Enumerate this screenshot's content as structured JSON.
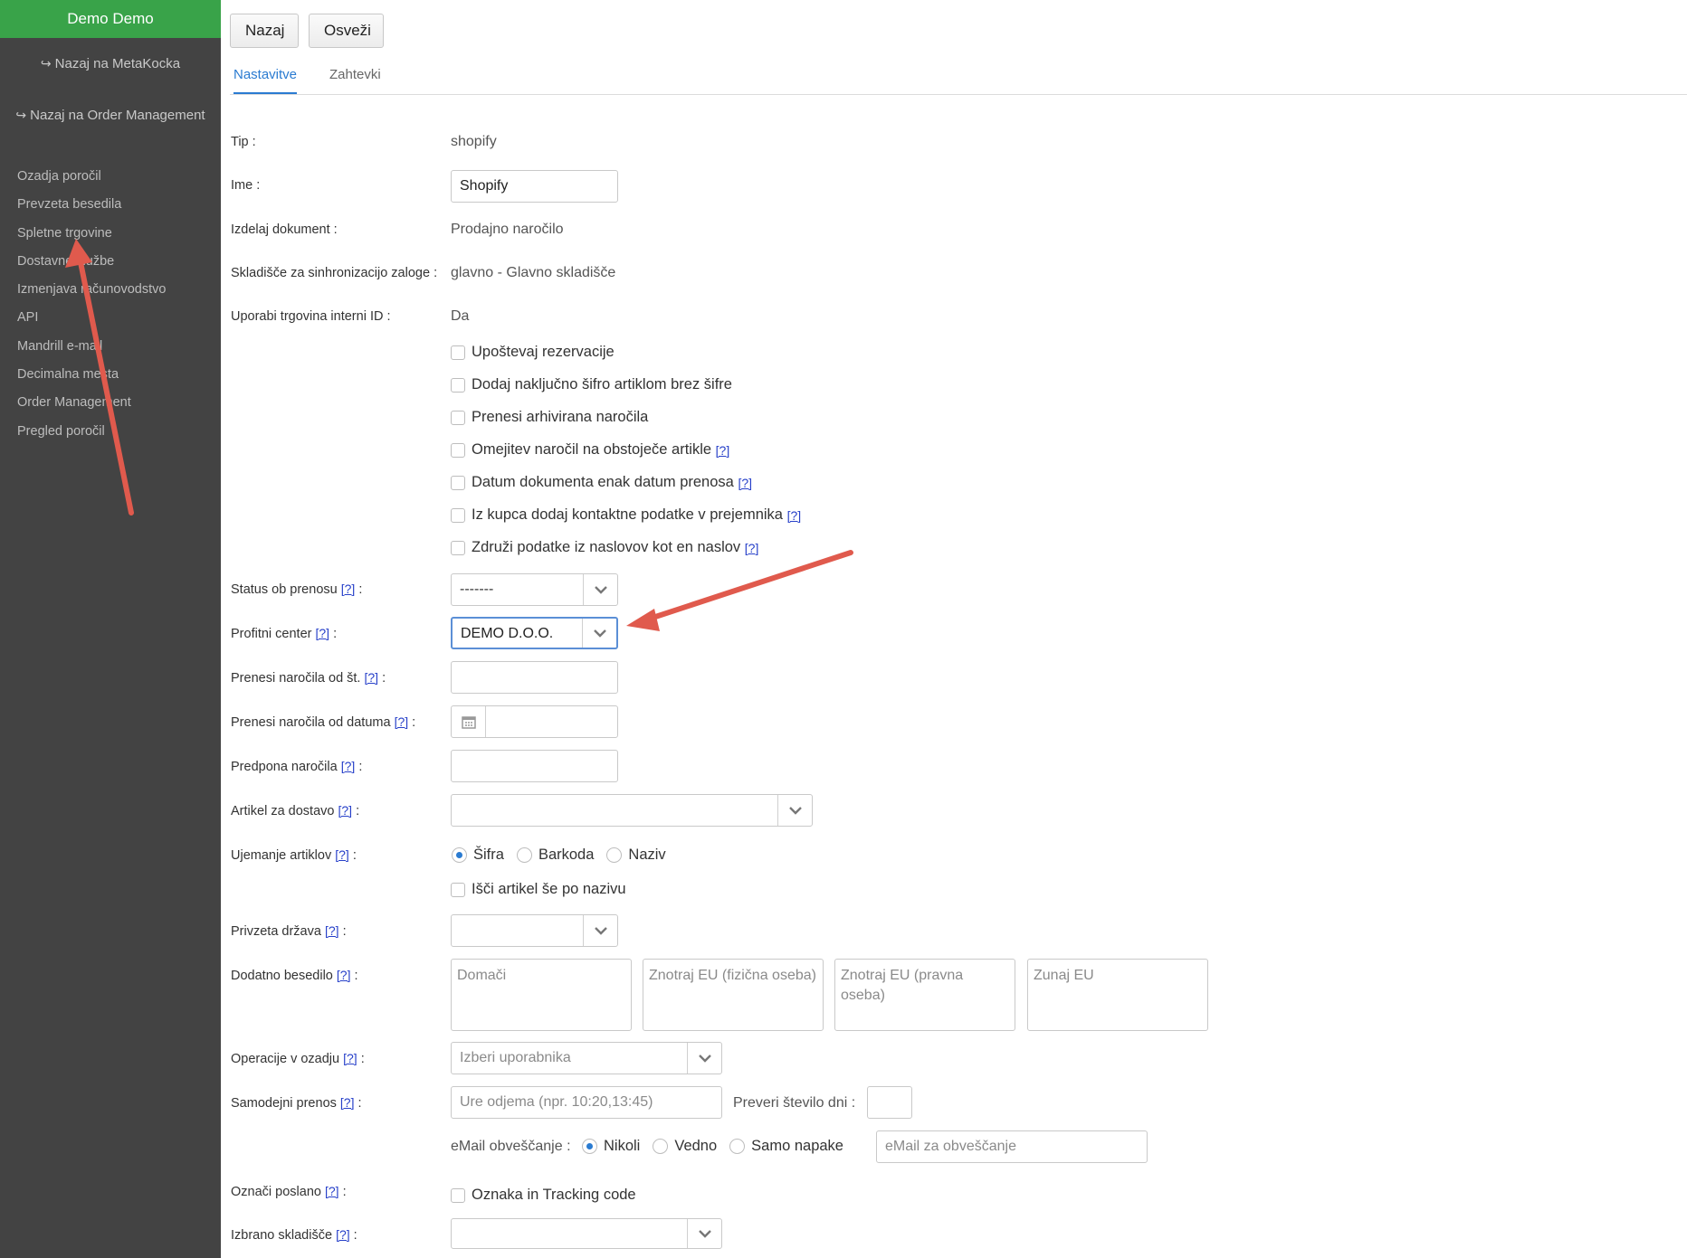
{
  "sidebar": {
    "user_name": "Demo Demo",
    "back_metakocka": "Nazaj na MetaKocka",
    "back_order_mgmt": "Nazaj na Order Management",
    "items": [
      {
        "label": "Ozadja poročil"
      },
      {
        "label": "Prevzeta besedila"
      },
      {
        "label": "Spletne trgovine"
      },
      {
        "label": "Dostavne službe"
      },
      {
        "label": "Izmenjava računovodstvo"
      },
      {
        "label": "API"
      },
      {
        "label": "Mandrill e-mail"
      },
      {
        "label": "Decimalna mesta"
      },
      {
        "label": "Order Management"
      },
      {
        "label": "Pregled poročil"
      }
    ]
  },
  "toolbar": {
    "back_label": "Nazaj",
    "refresh_label": "Osveži"
  },
  "tabs": {
    "settings": "Nastavitve",
    "requests": "Zahtevki"
  },
  "help_text": "[?]",
  "form": {
    "tip": {
      "label": "Tip :",
      "value": "shopify"
    },
    "ime": {
      "label": "Ime :",
      "value": "Shopify"
    },
    "izdelaj_dokument": {
      "label": "Izdelaj dokument :",
      "value": "Prodajno naročilo"
    },
    "skladisce_sinhro": {
      "label": "Skladišče za sinhronizacijo zaloge :",
      "value": "glavno - Glavno skladišče"
    },
    "interni_id": {
      "label": "Uporabi trgovina interni ID :",
      "value": "Da"
    },
    "checkboxes": [
      {
        "label": "Upoštevaj rezervacije",
        "checked": false
      },
      {
        "label": "Dodaj naključno šifro artiklom brez šifre",
        "checked": false
      },
      {
        "label": "Prenesi arhivirana naročila",
        "checked": false
      },
      {
        "label": "Omejitev naročil na obstoječe artikle",
        "checked": false
      },
      {
        "label": "Datum dokumenta enak datum prenosa",
        "checked": false
      },
      {
        "label": "Iz kupca dodaj kontaktne podatke v prejemnika",
        "checked": false
      },
      {
        "label": "Združi podatke iz naslovov kot en naslov",
        "checked": false
      }
    ],
    "status_ob_prenosu": {
      "label": "Status ob prenosu",
      "value": "-------"
    },
    "profitni_center": {
      "label": "Profitni center",
      "value": "DEMO D.O.O."
    },
    "prenesi_od_st": {
      "label": "Prenesi naročila od št.",
      "value": ""
    },
    "prenesi_od_datuma": {
      "label": "Prenesi naročila od datuma",
      "value": ""
    },
    "predpona": {
      "label": "Predpona naročila",
      "value": ""
    },
    "artikel_dostava": {
      "label": "Artikel za dostavo",
      "value": ""
    },
    "ujemanje": {
      "label": "Ujemanje artiklov",
      "options": [
        "Šifra",
        "Barkoda",
        "Naziv"
      ],
      "selected": "Šifra"
    },
    "isci_po_nazivu": {
      "label": "Išči artikel še po nazivu",
      "checked": false
    },
    "privzeta_drzava": {
      "label": "Privzeta država",
      "value": ""
    },
    "dodatno_besedilo": {
      "label": "Dodatno besedilo",
      "placeholders": [
        "Domači",
        "Znotraj EU (fizična oseba)",
        "Znotraj EU (pravna oseba)",
        "Zunaj EU"
      ]
    },
    "operacije_ozadje": {
      "label": "Operacije v ozadju",
      "placeholder": "Izberi uporabnika"
    },
    "samodejni_prenos": {
      "label": "Samodejni prenos",
      "placeholder": "Ure odjema (npr. 10:20,13:45)",
      "preveri_label": "Preveri število dni :"
    },
    "email": {
      "label": "eMail obveščanje :",
      "options": [
        "Nikoli",
        "Vedno",
        "Samo napake"
      ],
      "selected": "Nikoli",
      "placeholder": "eMail za obveščanje"
    },
    "oznaci_poslano": {
      "label": "Označi poslano",
      "checkbox_label": "Oznaka in Tracking code",
      "checked": false
    },
    "izbrano_skladisce": {
      "label": "Izbrano skladišče",
      "value": ""
    }
  },
  "colors": {
    "sidebar_bg": "#434343",
    "user_bar": "#39a349",
    "accent": "#2a7bd1",
    "annotation_arrow": "#e05a4d"
  }
}
